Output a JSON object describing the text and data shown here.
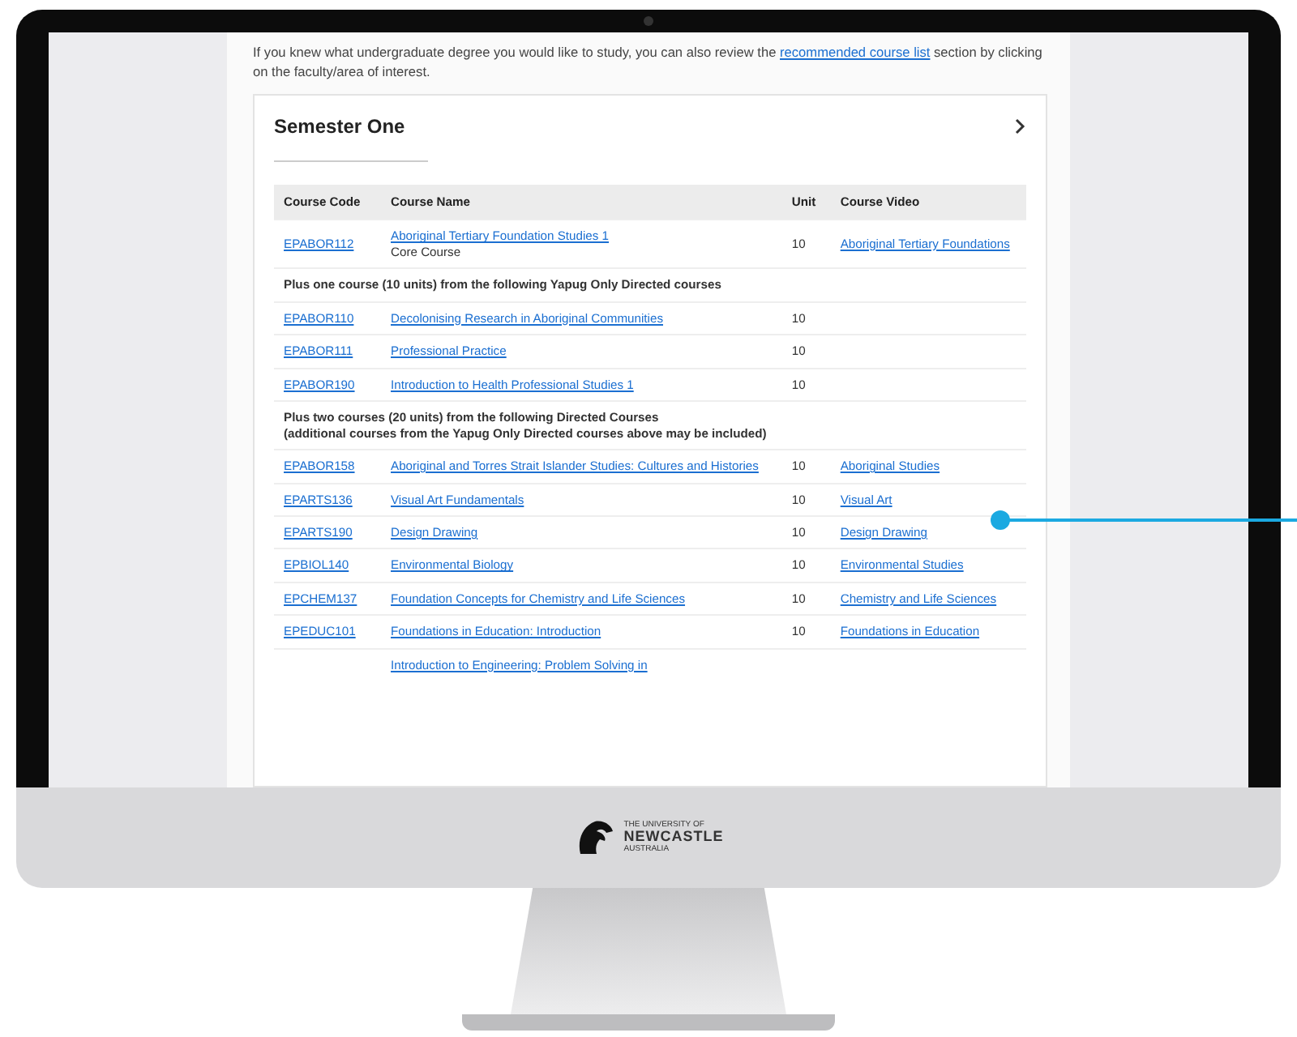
{
  "intro": {
    "before": "If you knew what undergraduate degree you would like to study, you can also review the ",
    "link": "recommended course list",
    "after": " section by clicking on the faculty/area of interest."
  },
  "card": {
    "title": "Semester One"
  },
  "table": {
    "columns": [
      "Course Code",
      "Course Name",
      "Unit",
      "Course Video"
    ],
    "rows": [
      {
        "kind": "course",
        "code": "EPABOR112",
        "name": "Aboriginal Tertiary Foundation Studies 1",
        "note": "Core Course",
        "unit": "10",
        "video": "Aboriginal Tertiary Foundations"
      },
      {
        "kind": "group",
        "lines": [
          "Plus one course (10 units) from the following Yapug Only Directed courses"
        ]
      },
      {
        "kind": "course",
        "code": "EPABOR110",
        "name": "Decolonising Research in Aboriginal Communities",
        "unit": "10"
      },
      {
        "kind": "course",
        "code": "EPABOR111",
        "name": "Professional Practice",
        "unit": "10"
      },
      {
        "kind": "course",
        "code": "EPABOR190",
        "name": "Introduction to Health Professional Studies 1",
        "unit": "10"
      },
      {
        "kind": "group",
        "lines": [
          "Plus two courses (20 units) from the following Directed Courses",
          "(additional courses from the Yapug Only Directed courses above may be included)"
        ]
      },
      {
        "kind": "course",
        "code": "EPABOR158",
        "name": "Aboriginal and Torres Strait Islander Studies: Cultures and Histories",
        "unit": "10",
        "video": "Aboriginal Studies"
      },
      {
        "kind": "course",
        "code": "EPARTS136",
        "name": "Visual Art Fundamentals",
        "unit": "10",
        "video": "Visual Art"
      },
      {
        "kind": "course",
        "code": "EPARTS190",
        "name": "Design Drawing",
        "unit": "10",
        "video": "Design Drawing"
      },
      {
        "kind": "course",
        "code": "EPBIOL140",
        "name": "Environmental Biology",
        "unit": "10",
        "video": "Environmental Studies"
      },
      {
        "kind": "course",
        "code": "EPCHEM137",
        "name": "Foundation Concepts for Chemistry and Life Sciences",
        "unit": "10",
        "video": "Chemistry and Life Sciences"
      },
      {
        "kind": "course",
        "code": "EPEDUC101",
        "name": "Foundations in Education: Introduction",
        "unit": "10",
        "video": "Foundations in Education"
      },
      {
        "kind": "course",
        "name": "Introduction to Engineering: Problem Solving in"
      }
    ]
  },
  "brand": {
    "lines": [
      "THE UNIVERSITY OF",
      "NEWCASTLE",
      "AUSTRALIA"
    ]
  }
}
